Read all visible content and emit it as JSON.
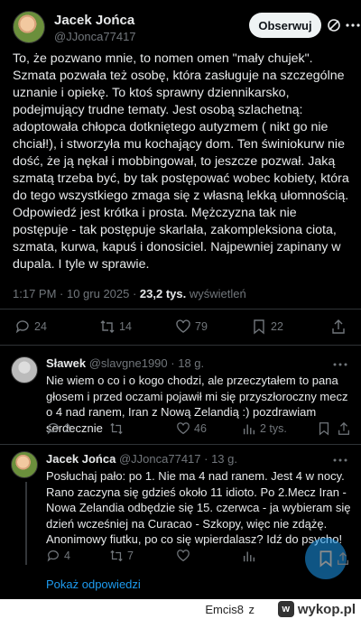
{
  "main_post": {
    "author_name": "Jacek Jońca",
    "author_handle": "@JJonca77417",
    "follow_label": "Obserwuj",
    "text": "To, że pozwano mnie, to nomen omen \"mały chujek\". Szmata pozwała też osobę, która zasługuje na szczególne uznanie i opiekę. To ktoś sprawny dziennikarsko, podejmujący trudne tematy. Jest osobą szlachetną: adoptowała chłopca dotkniętego autyzmem ( nikt go nie chciał!), i stworzyła mu kochający dom. Ten świniokurw nie dość, że ją nękał i mobbingował, to jeszcze pozwał. Jaką szmatą trzeba być, by tak postępować wobec kobiety, która do tego wszystkiego zmaga się z własną lekką ułomnością. Odpowiedź jest krótka i prosta. Mężczyzna tak nie postępuje - tak postępuje skarlała, zakompleksiona ciota, szmata, kurwa, kapuś i donosiciel. Najpewniej zapinany w dupala. I tyle w sprawie.",
    "time": "1:17 PM · 10 gru 2025 · ",
    "views": "23,2 tys.",
    "views_label": " wyświetleń",
    "stats": {
      "replies": "24",
      "reposts": "14",
      "likes": "79",
      "bookmarks": "22"
    }
  },
  "replies": [
    {
      "author_name": "Sławek",
      "author_handle": "@slavgne1990",
      "time": " · 18 g.",
      "text": "Nie wiem o co i o kogo chodzi, ale przeczytałem to pana głosem i przed oczami pojawił mi się przyszłoroczny mecz o 4 nad ranem, Iran z Nową Zelandią :) pozdrawiam serdecznie",
      "stats": {
        "replies": "2",
        "reposts": "",
        "likes": "46",
        "views": "2 tys."
      }
    },
    {
      "author_name": "Jacek Jońca",
      "author_handle": "@JJonca77417",
      "time": " · 13 g.",
      "text": "Posłuchaj pało: po 1. Nie ma 4 nad ranem. Jest 4 w nocy. Rano zaczyna się gdzieś około 11 idioto. Po 2.Mecz Iran - Nowa Zelandia odbędzie się 15. czerwca - ja wybieram się dzień wcześniej na Curacao - Szkopy, więc nie zdążę. Anonimowy fiutku, po co się wpierdalasz? Idź do psycho!",
      "stats": {
        "replies": "4",
        "reposts": "7",
        "likes": "",
        "views": ""
      }
    }
  ],
  "show_replies_label": "Pokaż odpowiedzi",
  "footer": {
    "user": "Emcis8",
    "z": "z",
    "site": "wykop.pl"
  },
  "colors": {
    "accent": "#1d9bf0",
    "background": "#000000",
    "muted": "#71767b"
  }
}
